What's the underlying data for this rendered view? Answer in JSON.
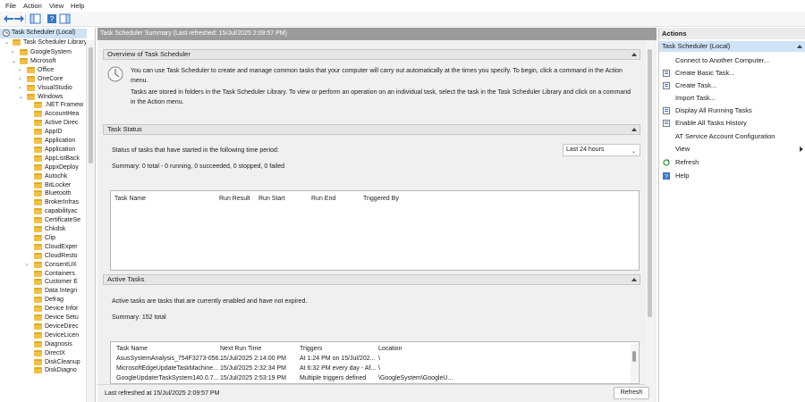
{
  "menu": [
    "File",
    "Action",
    "View",
    "Help"
  ],
  "tree": {
    "root": "Task Scheduler (Local)",
    "library": "Task Scheduler Library",
    "items": [
      {
        "label": "GoogleSystem",
        "indent": 1,
        "exp": "›"
      },
      {
        "label": "Microsoft",
        "indent": 1,
        "exp": "⌄"
      },
      {
        "label": "Office",
        "indent": 2,
        "exp": "›"
      },
      {
        "label": "OneCore",
        "indent": 2,
        "exp": "›"
      },
      {
        "label": "VisualStudio",
        "indent": 2,
        "exp": "›"
      },
      {
        "label": "Windows",
        "indent": 2,
        "exp": "⌄"
      },
      {
        "label": ".NET Framew",
        "indent": 3,
        "exp": ""
      },
      {
        "label": "AccountHea",
        "indent": 3,
        "exp": ""
      },
      {
        "label": "Active Direc",
        "indent": 3,
        "exp": ""
      },
      {
        "label": "AppID",
        "indent": 3,
        "exp": ""
      },
      {
        "label": "Application",
        "indent": 3,
        "exp": ""
      },
      {
        "label": "Application",
        "indent": 3,
        "exp": ""
      },
      {
        "label": "AppListBack",
        "indent": 3,
        "exp": ""
      },
      {
        "label": "AppxDeploy",
        "indent": 3,
        "exp": ""
      },
      {
        "label": "Autochk",
        "indent": 3,
        "exp": ""
      },
      {
        "label": "BitLocker",
        "indent": 3,
        "exp": ""
      },
      {
        "label": "Bluetooth",
        "indent": 3,
        "exp": ""
      },
      {
        "label": "BrokerInfras",
        "indent": 3,
        "exp": ""
      },
      {
        "label": "capabilityac",
        "indent": 3,
        "exp": ""
      },
      {
        "label": "CertificateSe",
        "indent": 3,
        "exp": ""
      },
      {
        "label": "Chkdsk",
        "indent": 3,
        "exp": ""
      },
      {
        "label": "Clip",
        "indent": 3,
        "exp": ""
      },
      {
        "label": "CloudExper",
        "indent": 3,
        "exp": ""
      },
      {
        "label": "CloudResto",
        "indent": 3,
        "exp": ""
      },
      {
        "label": "ConsentUX",
        "indent": 3,
        "exp": "›"
      },
      {
        "label": "Containers",
        "indent": 3,
        "exp": ""
      },
      {
        "label": "Customer E",
        "indent": 3,
        "exp": ""
      },
      {
        "label": "Data Integri",
        "indent": 3,
        "exp": ""
      },
      {
        "label": "Defrag",
        "indent": 3,
        "exp": ""
      },
      {
        "label": "Device Infor",
        "indent": 3,
        "exp": ""
      },
      {
        "label": "Device Setu",
        "indent": 3,
        "exp": ""
      },
      {
        "label": "DeviceDirec",
        "indent": 3,
        "exp": ""
      },
      {
        "label": "DeviceLicen",
        "indent": 3,
        "exp": ""
      },
      {
        "label": "Diagnosis",
        "indent": 3,
        "exp": ""
      },
      {
        "label": "DirectX",
        "indent": 3,
        "exp": ""
      },
      {
        "label": "DiskCleanup",
        "indent": 3,
        "exp": ""
      },
      {
        "label": "DiskDiagno",
        "indent": 3,
        "exp": ""
      }
    ]
  },
  "center": {
    "title": "Task Scheduler Summary (Last refreshed: 15/Jul/2025 2:09:57 PM)",
    "overview": {
      "header": "Overview of Task Scheduler",
      "line1a": "You can use Task Scheduler to create and manage common tasks that your computer will carry out automatically at the times you specify. To begin, click a command in the Action",
      "line1b": "menu.",
      "line2a": "Tasks are stored in folders in the Task Scheduler Library. To view or perform an operation on an individual task, select the task in the Task Scheduler Library and click on a command",
      "line2b": "in the Action menu."
    },
    "status": {
      "header": "Task Status",
      "label": "Status of tasks that have started in the following time period:",
      "period": "Last 24 hours",
      "summary": "Summary: 0 total - 0 running, 0 succeeded, 0 stopped, 0 failed",
      "columns": [
        "Task Name",
        "Run Result",
        "Run Start",
        "Run End",
        "Triggered By"
      ]
    },
    "active": {
      "header": "Active Tasks",
      "desc": "Active tasks are tasks that are currently enabled and have not expired.",
      "summary": "Summary: 152 total",
      "columns": [
        "Task Name",
        "Next Run Time",
        "Triggers",
        "Location"
      ],
      "rows": [
        [
          "AsusSystemAnalysis_754F3273-056...",
          "15/Jul/2025 2:14:00 PM",
          "At 1:24 PM on 15/Jul/202...",
          "\\"
        ],
        [
          "MicrosoftEdgeUpdateTaskMachine...",
          "15/Jul/2025 2:32:34 PM",
          "At 6:32 PM every day - Af...",
          "\\"
        ],
        [
          "GoogleUpdaterTaskSystem140.0.7...",
          "15/Jul/2025 2:53:19 PM",
          "Multiple triggers defined",
          "\\GoogleSystem\\GoogleU..."
        ]
      ]
    },
    "footer": "Last refreshed at 15/Jul/2025 2:09:57 PM",
    "refresh": "Refresh"
  },
  "actions": {
    "title": "Actions",
    "sub": "Task Scheduler (Local)",
    "items": [
      {
        "label": "Connect to Another Computer...",
        "icon": ""
      },
      {
        "label": "Create Basic Task...",
        "icon": "create-basic-task-icon"
      },
      {
        "label": "Create Task...",
        "icon": "create-task-icon"
      },
      {
        "label": "Import Task...",
        "icon": ""
      },
      {
        "label": "Display All Running Tasks",
        "icon": "running-tasks-icon"
      },
      {
        "label": "Enable All Tasks History",
        "icon": "history-icon"
      },
      {
        "label": "AT Service Account Configuration",
        "icon": ""
      },
      {
        "label": "View",
        "icon": ""
      },
      {
        "label": "Refresh",
        "icon": "refresh-icon"
      },
      {
        "label": "Help",
        "icon": "help-icon"
      }
    ]
  }
}
